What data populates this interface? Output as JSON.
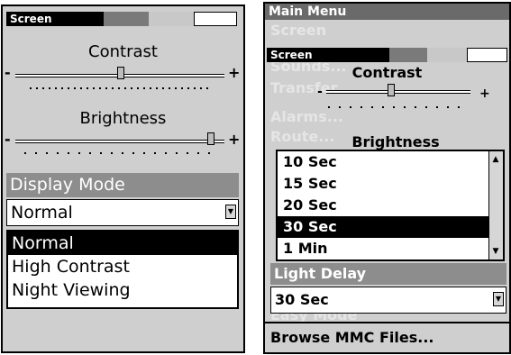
{
  "left_panel": {
    "title": "Screen",
    "contrast_label": "Contrast",
    "brightness_label": "Brightness",
    "minus": "-",
    "plus": "+",
    "display_mode_label": "Display Mode",
    "display_mode_value": "Normal",
    "options": [
      "Normal",
      "High Contrast",
      "Night Viewing"
    ],
    "selected_option": "Normal"
  },
  "right_panel": {
    "main_menu_title": "Main Menu",
    "faded_items": [
      "Screen",
      "Sounds...",
      "Transfer...",
      "Alarms...",
      "Route...",
      "Easy Mode"
    ],
    "popup_title": "Screen",
    "contrast_label": "Contrast",
    "brightness_label": "Brightness",
    "minus": "-",
    "plus": "+",
    "delay_options": [
      "10 Sec",
      "15 Sec",
      "20 Sec",
      "30 Sec",
      "1 Min"
    ],
    "selected_delay_option": "30 Sec",
    "light_delay_label": "Light Delay",
    "light_delay_value": "30 Sec",
    "browse_label": "Browse MMC Files..."
  },
  "colors": {
    "panel_bg": "#cfcfcf",
    "label_bar": "#8d8d8d",
    "selection": "#000000"
  }
}
